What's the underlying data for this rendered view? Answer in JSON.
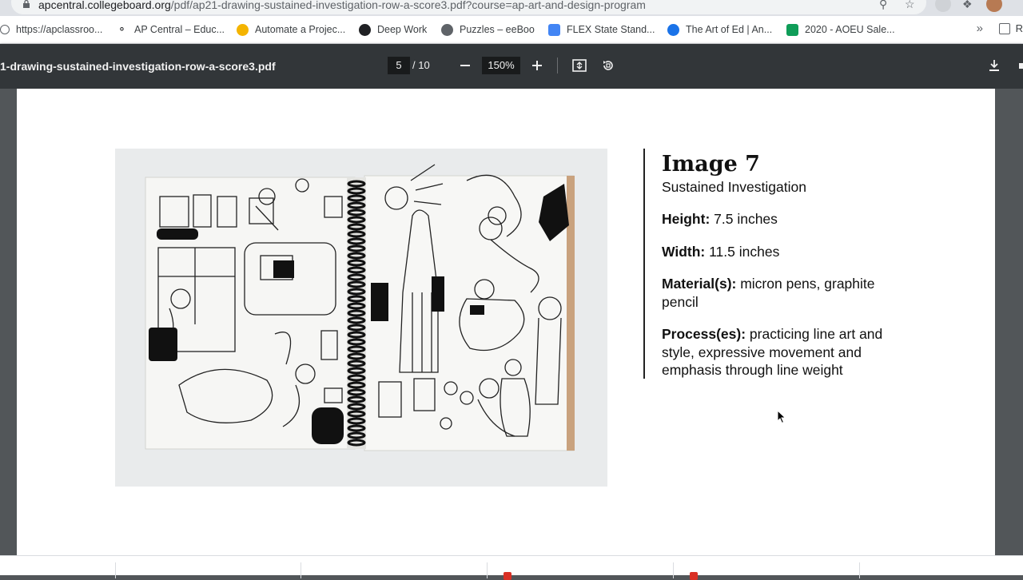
{
  "browser": {
    "url_host": "apcentral.collegeboard.org",
    "url_path": "/pdf/ap21-drawing-sustained-investigation-row-a-score3.pdf?course=ap-art-and-design-program",
    "bookmarks": [
      {
        "label": "https://apclassroo...",
        "icon": "globe-icon",
        "color": "#5f6368"
      },
      {
        "label": "AP Central – Educ...",
        "icon": "acorn-icon",
        "color": "#202124"
      },
      {
        "label": "Automate a Projec...",
        "icon": "globe-icon",
        "color": "#f4b400"
      },
      {
        "label": "Deep Work",
        "icon": "eye-icon",
        "color": "#202124"
      },
      {
        "label": "Puzzles – eeBoo",
        "icon": "globe-icon",
        "color": "#5f6368"
      },
      {
        "label": "FLEX State Stand...",
        "icon": "docs-icon",
        "color": "#4285f4"
      },
      {
        "label": "The Art of Ed | An...",
        "icon": "art-icon",
        "color": "#1a73e8"
      },
      {
        "label": "2020 - AOEU Sale...",
        "icon": "sheets-icon",
        "color": "#0f9d58"
      }
    ],
    "bookmarks_more": "»",
    "bookmarks_right": "R"
  },
  "pdf_toolbar": {
    "title": "1-drawing-sustained-investigation-row-a-score3.pdf",
    "page_current": "5",
    "page_total": "/ 10",
    "zoom": "150%"
  },
  "page_content": {
    "heading": "Image 7",
    "subheading": "Sustained Investigation",
    "height_label": "Height:",
    "height_value": " 7.5 inches",
    "width_label": "Width:",
    "width_value": " 11.5 inches",
    "materials_label": "Material(s):",
    "materials_value": " micron pens, graphite pencil",
    "process_label": "Process(es):",
    "process_value": " practicing line art and style, expressive movement and emphasis through line weight"
  },
  "colors": {
    "toolbar_bg": "#323639",
    "viewer_bg": "#525659",
    "page_bg": "#ffffff"
  }
}
